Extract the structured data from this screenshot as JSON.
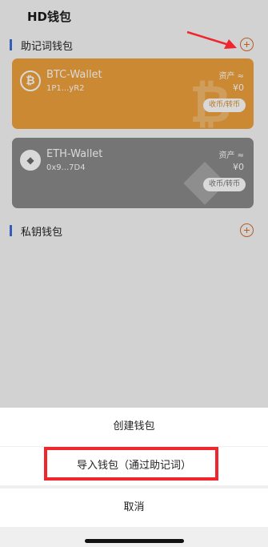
{
  "header": {
    "title": "HD钱包"
  },
  "sections": {
    "mnemonic": {
      "label": "助记词钱包"
    },
    "private_key": {
      "label": "私钥钱包"
    }
  },
  "wallets": [
    {
      "name": "BTC-Wallet",
      "address": "1P1...yR2",
      "asset_label": "资产 ≈",
      "asset_value": "¥0",
      "action": "收币/转币",
      "icon": "bitcoin-icon",
      "color": "#f0a23d"
    },
    {
      "name": "ETH-Wallet",
      "address": "0x9...7D4",
      "asset_label": "资产 ≈",
      "asset_value": "¥0",
      "action": "收币/转币",
      "icon": "ethereum-icon",
      "color": "#8a8a8a"
    }
  ],
  "action_sheet": {
    "create": "创建钱包",
    "import": "导入钱包（通过助记词）",
    "cancel": "取消"
  },
  "annotations": {
    "highlight_color": "#f0262e"
  }
}
